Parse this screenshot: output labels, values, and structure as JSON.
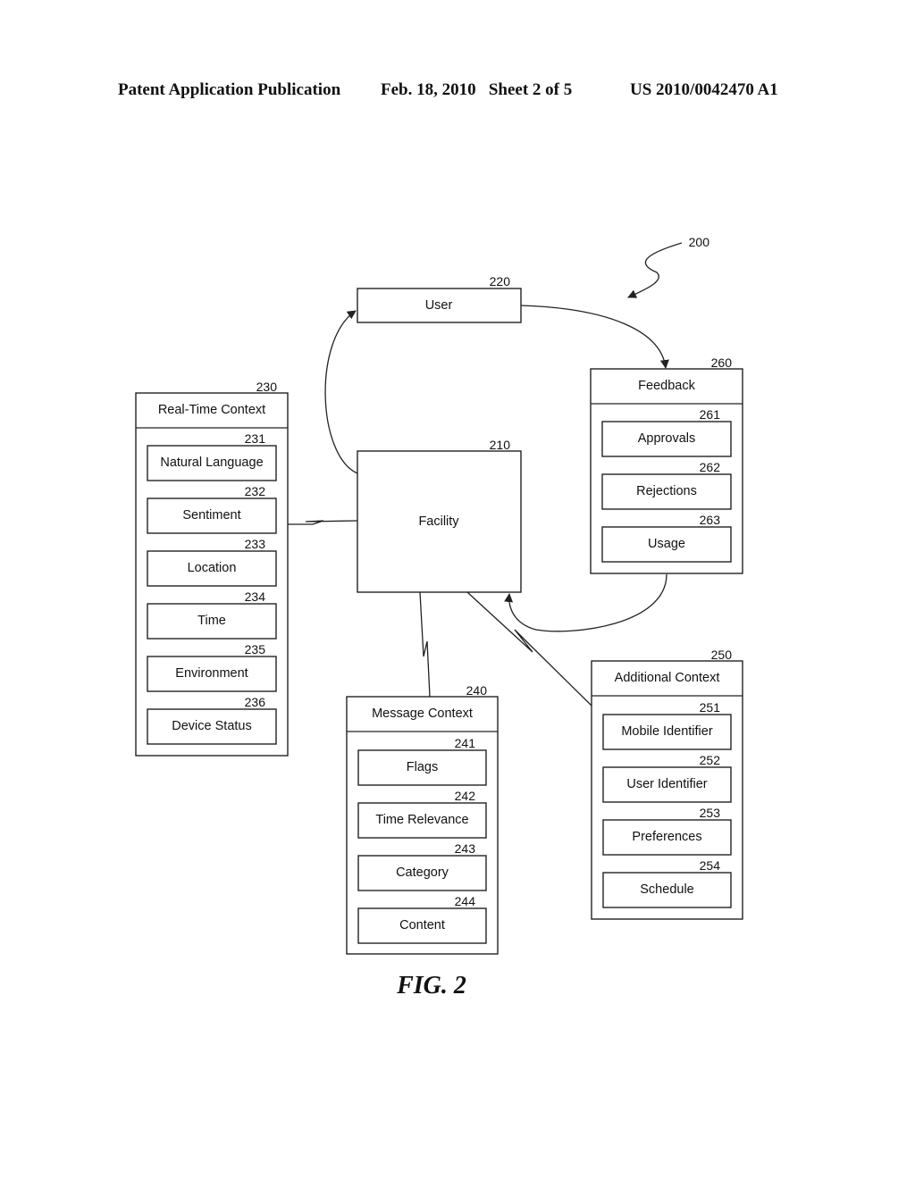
{
  "header": {
    "left": "Patent Application Publication",
    "center": "Feb. 18, 2010   Sheet 2 of 5",
    "right": "US 2010/0042470 A1"
  },
  "figure_ref": "200",
  "figure_caption": "FIG. 2",
  "nodes": {
    "facility": {
      "ref": "210",
      "label": "Facility"
    },
    "user": {
      "ref": "220",
      "label": "User"
    },
    "realtime": {
      "ref": "230",
      "label": "Real-Time Context",
      "items": [
        {
          "ref": "231",
          "label": "Natural Language"
        },
        {
          "ref": "232",
          "label": "Sentiment"
        },
        {
          "ref": "233",
          "label": "Location"
        },
        {
          "ref": "234",
          "label": "Time"
        },
        {
          "ref": "235",
          "label": "Environment"
        },
        {
          "ref": "236",
          "label": "Device Status"
        }
      ]
    },
    "message": {
      "ref": "240",
      "label": "Message Context",
      "items": [
        {
          "ref": "241",
          "label": "Flags"
        },
        {
          "ref": "242",
          "label": "Time Relevance"
        },
        {
          "ref": "243",
          "label": "Category"
        },
        {
          "ref": "244",
          "label": "Content"
        }
      ]
    },
    "additional": {
      "ref": "250",
      "label": "Additional Context",
      "items": [
        {
          "ref": "251",
          "label": "Mobile Identifier"
        },
        {
          "ref": "252",
          "label": "User Identifier"
        },
        {
          "ref": "253",
          "label": "Preferences"
        },
        {
          "ref": "254",
          "label": "Schedule"
        }
      ]
    },
    "feedback": {
      "ref": "260",
      "label": "Feedback",
      "items": [
        {
          "ref": "261",
          "label": "Approvals"
        },
        {
          "ref": "262",
          "label": "Rejections"
        },
        {
          "ref": "263",
          "label": "Usage"
        }
      ]
    }
  },
  "connections": [
    {
      "from": "facility",
      "to": "user",
      "type": "arrow"
    },
    {
      "from": "user",
      "to": "feedback",
      "type": "arrow"
    },
    {
      "from": "feedback",
      "to": "facility",
      "type": "arrow"
    },
    {
      "from": "realtime",
      "to": "facility",
      "type": "link"
    },
    {
      "from": "message",
      "to": "facility",
      "type": "link"
    },
    {
      "from": "additional",
      "to": "facility",
      "type": "link"
    }
  ]
}
